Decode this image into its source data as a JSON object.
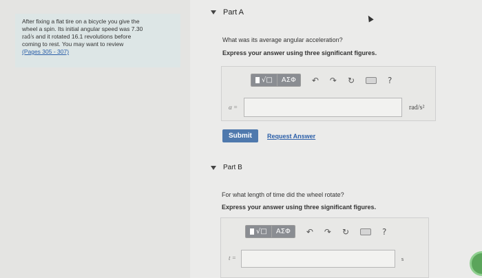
{
  "problem": {
    "line1": "After fixing a flat tire on a bicycle you give the",
    "line2": "wheel a spin. Its initial angular speed was 7.30",
    "line3_unit": "rad/s",
    "line3_rest": " and it rotated 16.1 revolutions before",
    "line4": "coming to rest. You may want to review",
    "link": "(Pages 305 - 307)"
  },
  "partA": {
    "title": "Part A",
    "question": "What was its average angular acceleration?",
    "instruction": "Express your answer using three significant figures.",
    "variable": "α =",
    "unit": "rad/s²",
    "input_value": "",
    "submit_label": "Submit",
    "request_label": "Request Answer"
  },
  "partB": {
    "title": "Part B",
    "question": "For what length of time did the wheel rotate?",
    "instruction": "Express your answer using three significant figures.",
    "variable": "t =",
    "unit": "s",
    "input_value": ""
  },
  "toolbar": {
    "templates_label": "√□",
    "greek_label": "ΑΣΦ",
    "undo_glyph": "↶",
    "redo_glyph": "↷",
    "reset_glyph": "↻",
    "help_glyph": "?"
  }
}
